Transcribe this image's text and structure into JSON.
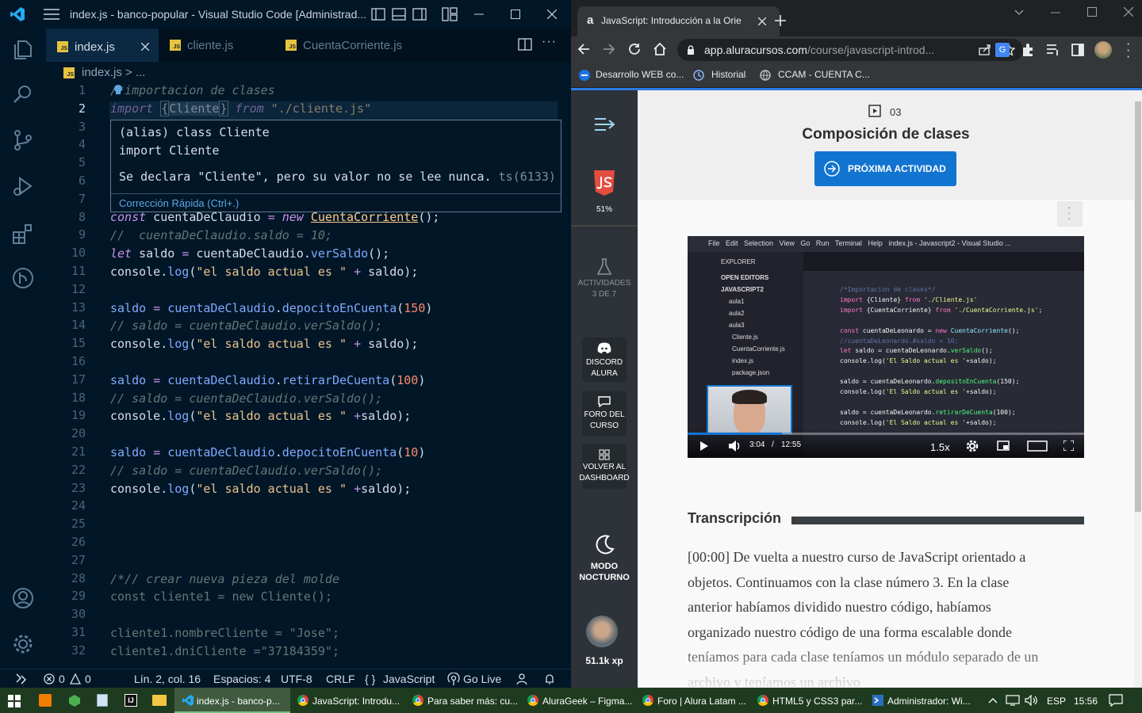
{
  "vscode": {
    "title": "index.js - banco-popular - Visual Studio Code [Administrad...",
    "tabs": [
      {
        "label": "index.js",
        "active": true
      },
      {
        "label": "cliente.js",
        "active": false
      },
      {
        "label": "CuentaCorriente.js",
        "active": false
      }
    ],
    "breadcrumb": "index.js > ...",
    "badge_js": "JS",
    "hover": {
      "line1": "(alias) class Cliente",
      "line2": "import Cliente",
      "message": "Se declara \"Cliente\", pero su valor no se lee nunca.",
      "code": "ts(6133)",
      "quick_fix": "Corrección Rápida (Ctrl+.)"
    },
    "line_numbers": [
      "1",
      "2",
      "3",
      "4",
      "5",
      "6",
      "7",
      "8",
      "9",
      "10",
      "11",
      "12",
      "13",
      "14",
      "15",
      "16",
      "17",
      "18",
      "19",
      "20",
      "21",
      "22",
      "23",
      "24",
      "25",
      "26",
      "27",
      "28",
      "29",
      "30",
      "31",
      "32"
    ],
    "status": {
      "errors": "0",
      "warnings": "0",
      "position": "Lín. 2, col. 16",
      "spaces": "Espacios: 4",
      "encoding": "UTF-8",
      "eol": "CRLF",
      "language": "JavaScript",
      "golive": "Go Live"
    }
  },
  "chrome": {
    "tab_title": "JavaScript: Introducción a la Orie",
    "url_host": "app.aluracursos.com",
    "url_path": "/course/javascript-introd...",
    "bookmarks": [
      "Desarrollo WEB co...",
      "Historial",
      "CCAM - CUENTA C..."
    ],
    "sidebar": {
      "progress": "51%",
      "activities": "ACTIVIDADES",
      "activities_count": "3 DE 7",
      "discord_1": "DISCORD",
      "discord_2": "ALURA",
      "foro_1": "FORO DEL",
      "foro_2": "CURSO",
      "volver_1": "VOLVER AL",
      "volver_2": "DASHBOARD",
      "modo_1": "MODO",
      "modo_2": "NOCTURNO",
      "xp": "51.1k xp"
    },
    "lesson_number": "03",
    "lesson_title": "Composición de clases",
    "next_button": "PRÓXIMA ACTIVIDAD",
    "video": {
      "time_current": "3:04",
      "time_sep": "/",
      "time_total": "12:55",
      "speed": "1.5x"
    },
    "transcript_title": "Transcripción",
    "transcript_text": "[00:00] De vuelta a nuestro curso de JavaScript orientado a objetos. Continuamos con la clase número 3. En la clase anterior habíamos dividido nuestro código, habíamos organizado nuestro código de una forma escalable donde teníamos para cada clase teníamos un módulo separado de un archivo y teníamos un archivo"
  },
  "taskbar": {
    "items": [
      "index.js - banco-p...",
      "JavaScript: Introdu...",
      "Para saber más: cu...",
      "AluraGeek – Figma...",
      "Foro | Alura Latam ...",
      "HTML5 y CSS3 par...",
      "Administrador: Wi..."
    ],
    "lang": "ESP",
    "time": "15:56"
  },
  "colors": {
    "vscode_bg": "#011627",
    "accent": "#1274d1",
    "taskbar": "#1f3b1f"
  }
}
